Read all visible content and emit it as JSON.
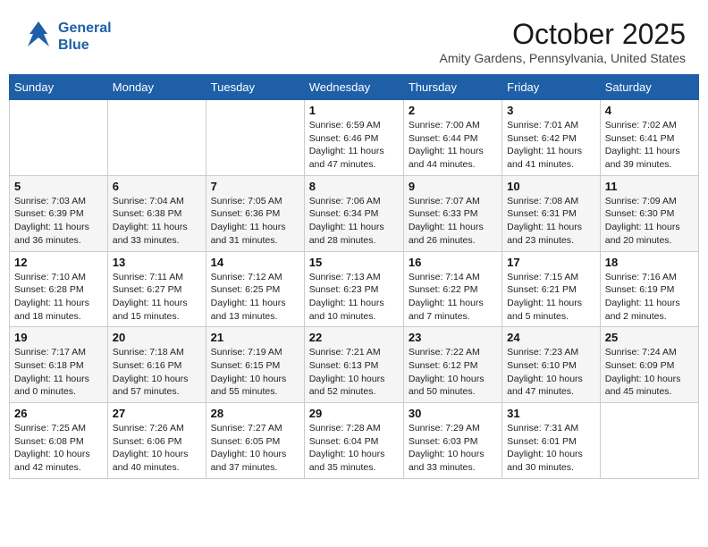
{
  "header": {
    "logo_line1": "General",
    "logo_line2": "Blue",
    "month": "October 2025",
    "location": "Amity Gardens, Pennsylvania, United States"
  },
  "weekdays": [
    "Sunday",
    "Monday",
    "Tuesday",
    "Wednesday",
    "Thursday",
    "Friday",
    "Saturday"
  ],
  "weeks": [
    [
      {
        "day": "",
        "content": ""
      },
      {
        "day": "",
        "content": ""
      },
      {
        "day": "",
        "content": ""
      },
      {
        "day": "1",
        "content": "Sunrise: 6:59 AM\nSunset: 6:46 PM\nDaylight: 11 hours and 47 minutes."
      },
      {
        "day": "2",
        "content": "Sunrise: 7:00 AM\nSunset: 6:44 PM\nDaylight: 11 hours and 44 minutes."
      },
      {
        "day": "3",
        "content": "Sunrise: 7:01 AM\nSunset: 6:42 PM\nDaylight: 11 hours and 41 minutes."
      },
      {
        "day": "4",
        "content": "Sunrise: 7:02 AM\nSunset: 6:41 PM\nDaylight: 11 hours and 39 minutes."
      }
    ],
    [
      {
        "day": "5",
        "content": "Sunrise: 7:03 AM\nSunset: 6:39 PM\nDaylight: 11 hours and 36 minutes."
      },
      {
        "day": "6",
        "content": "Sunrise: 7:04 AM\nSunset: 6:38 PM\nDaylight: 11 hours and 33 minutes."
      },
      {
        "day": "7",
        "content": "Sunrise: 7:05 AM\nSunset: 6:36 PM\nDaylight: 11 hours and 31 minutes."
      },
      {
        "day": "8",
        "content": "Sunrise: 7:06 AM\nSunset: 6:34 PM\nDaylight: 11 hours and 28 minutes."
      },
      {
        "day": "9",
        "content": "Sunrise: 7:07 AM\nSunset: 6:33 PM\nDaylight: 11 hours and 26 minutes."
      },
      {
        "day": "10",
        "content": "Sunrise: 7:08 AM\nSunset: 6:31 PM\nDaylight: 11 hours and 23 minutes."
      },
      {
        "day": "11",
        "content": "Sunrise: 7:09 AM\nSunset: 6:30 PM\nDaylight: 11 hours and 20 minutes."
      }
    ],
    [
      {
        "day": "12",
        "content": "Sunrise: 7:10 AM\nSunset: 6:28 PM\nDaylight: 11 hours and 18 minutes."
      },
      {
        "day": "13",
        "content": "Sunrise: 7:11 AM\nSunset: 6:27 PM\nDaylight: 11 hours and 15 minutes."
      },
      {
        "day": "14",
        "content": "Sunrise: 7:12 AM\nSunset: 6:25 PM\nDaylight: 11 hours and 13 minutes."
      },
      {
        "day": "15",
        "content": "Sunrise: 7:13 AM\nSunset: 6:23 PM\nDaylight: 11 hours and 10 minutes."
      },
      {
        "day": "16",
        "content": "Sunrise: 7:14 AM\nSunset: 6:22 PM\nDaylight: 11 hours and 7 minutes."
      },
      {
        "day": "17",
        "content": "Sunrise: 7:15 AM\nSunset: 6:21 PM\nDaylight: 11 hours and 5 minutes."
      },
      {
        "day": "18",
        "content": "Sunrise: 7:16 AM\nSunset: 6:19 PM\nDaylight: 11 hours and 2 minutes."
      }
    ],
    [
      {
        "day": "19",
        "content": "Sunrise: 7:17 AM\nSunset: 6:18 PM\nDaylight: 11 hours and 0 minutes."
      },
      {
        "day": "20",
        "content": "Sunrise: 7:18 AM\nSunset: 6:16 PM\nDaylight: 10 hours and 57 minutes."
      },
      {
        "day": "21",
        "content": "Sunrise: 7:19 AM\nSunset: 6:15 PM\nDaylight: 10 hours and 55 minutes."
      },
      {
        "day": "22",
        "content": "Sunrise: 7:21 AM\nSunset: 6:13 PM\nDaylight: 10 hours and 52 minutes."
      },
      {
        "day": "23",
        "content": "Sunrise: 7:22 AM\nSunset: 6:12 PM\nDaylight: 10 hours and 50 minutes."
      },
      {
        "day": "24",
        "content": "Sunrise: 7:23 AM\nSunset: 6:10 PM\nDaylight: 10 hours and 47 minutes."
      },
      {
        "day": "25",
        "content": "Sunrise: 7:24 AM\nSunset: 6:09 PM\nDaylight: 10 hours and 45 minutes."
      }
    ],
    [
      {
        "day": "26",
        "content": "Sunrise: 7:25 AM\nSunset: 6:08 PM\nDaylight: 10 hours and 42 minutes."
      },
      {
        "day": "27",
        "content": "Sunrise: 7:26 AM\nSunset: 6:06 PM\nDaylight: 10 hours and 40 minutes."
      },
      {
        "day": "28",
        "content": "Sunrise: 7:27 AM\nSunset: 6:05 PM\nDaylight: 10 hours and 37 minutes."
      },
      {
        "day": "29",
        "content": "Sunrise: 7:28 AM\nSunset: 6:04 PM\nDaylight: 10 hours and 35 minutes."
      },
      {
        "day": "30",
        "content": "Sunrise: 7:29 AM\nSunset: 6:03 PM\nDaylight: 10 hours and 33 minutes."
      },
      {
        "day": "31",
        "content": "Sunrise: 7:31 AM\nSunset: 6:01 PM\nDaylight: 10 hours and 30 minutes."
      },
      {
        "day": "",
        "content": ""
      }
    ]
  ]
}
